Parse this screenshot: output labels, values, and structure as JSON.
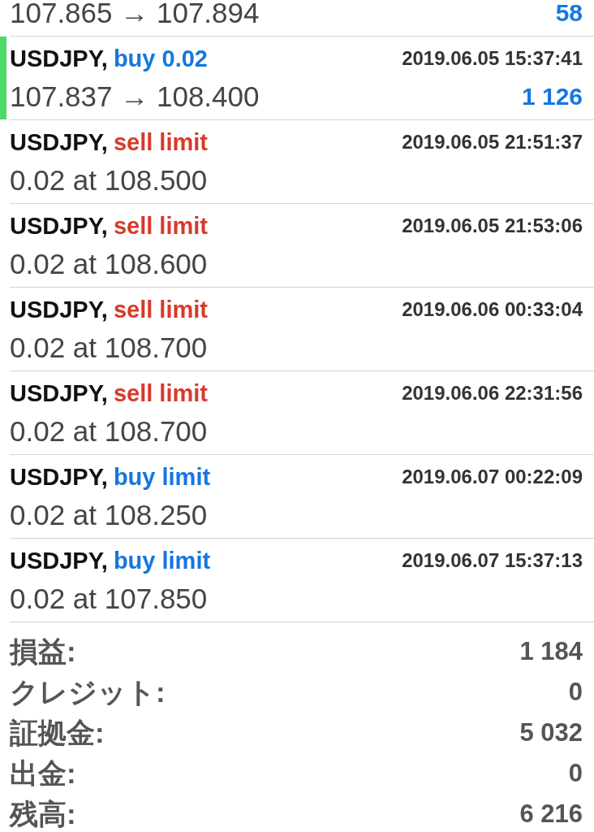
{
  "orders": [
    {
      "details": "107.865 → 107.894",
      "profit": "58",
      "selected": false
    },
    {
      "symbol": "USDJPY,",
      "type": "buy 0.02",
      "color": "#1577e0",
      "time": "2019.06.05 15:37:41",
      "details": "107.837 → 108.400",
      "profit": "1 126",
      "selected": true
    },
    {
      "symbol": "USDJPY,",
      "type": "sell limit",
      "color": "#d8392b",
      "time": "2019.06.05 21:51:37",
      "details": "0.02 at 108.500",
      "selected": false
    },
    {
      "symbol": "USDJPY,",
      "type": "sell limit",
      "color": "#d8392b",
      "time": "2019.06.05 21:53:06",
      "details": "0.02 at 108.600",
      "selected": false
    },
    {
      "symbol": "USDJPY,",
      "type": "sell limit",
      "color": "#d8392b",
      "time": "2019.06.06 00:33:04",
      "details": "0.02 at 108.700",
      "selected": false
    },
    {
      "symbol": "USDJPY,",
      "type": "sell limit",
      "color": "#d8392b",
      "time": "2019.06.06 22:31:56",
      "details": "0.02 at 108.700",
      "selected": false
    },
    {
      "symbol": "USDJPY,",
      "type": "buy limit",
      "color": "#1577e0",
      "time": "2019.06.07 00:22:09",
      "details": "0.02 at 108.250",
      "selected": false
    },
    {
      "symbol": "USDJPY,",
      "type": "buy limit",
      "color": "#1577e0",
      "time": "2019.06.07 15:37:13",
      "details": "0.02 at 107.850",
      "selected": false
    }
  ],
  "summary": [
    {
      "label": "損益:",
      "value": "1 184"
    },
    {
      "label": "クレジット:",
      "value": "0"
    },
    {
      "label": "証拠金:",
      "value": "5 032"
    },
    {
      "label": "出金:",
      "value": "0"
    },
    {
      "label": "残高:",
      "value": "6 216"
    }
  ]
}
